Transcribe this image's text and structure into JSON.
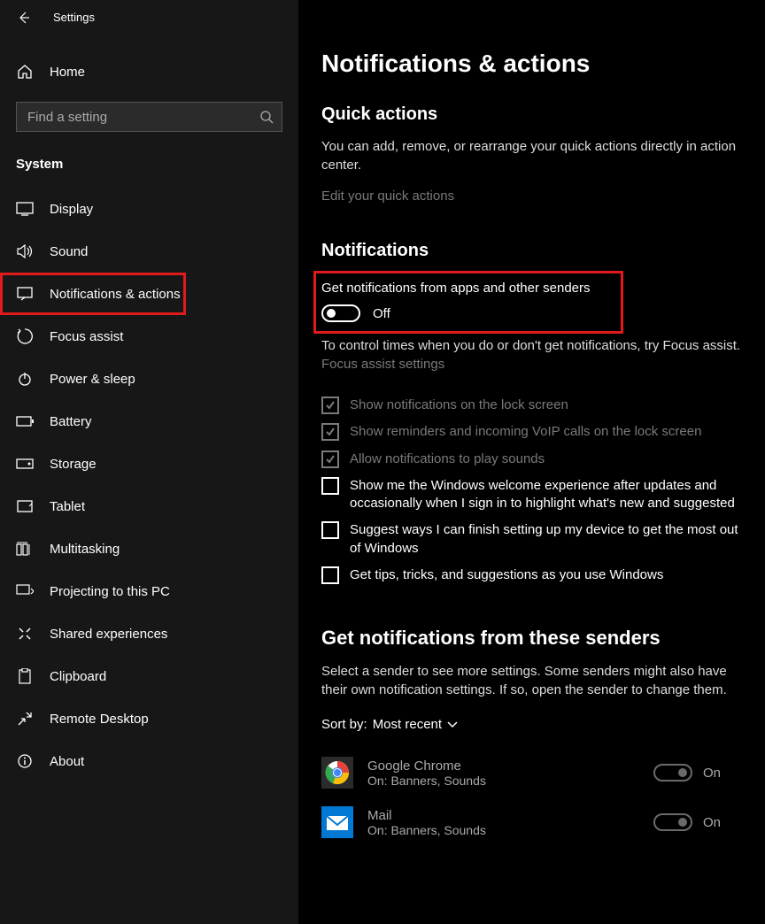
{
  "titlebar": {
    "title": "Settings"
  },
  "sidebar": {
    "home": "Home",
    "search_placeholder": "Find a setting",
    "section": "System",
    "items": [
      {
        "label": "Display"
      },
      {
        "label": "Sound"
      },
      {
        "label": "Notifications & actions"
      },
      {
        "label": "Focus assist"
      },
      {
        "label": "Power & sleep"
      },
      {
        "label": "Battery"
      },
      {
        "label": "Storage"
      },
      {
        "label": "Tablet"
      },
      {
        "label": "Multitasking"
      },
      {
        "label": "Projecting to this PC"
      },
      {
        "label": "Shared experiences"
      },
      {
        "label": "Clipboard"
      },
      {
        "label": "Remote Desktop"
      },
      {
        "label": "About"
      }
    ]
  },
  "main": {
    "heading": "Notifications & actions",
    "quick_actions": {
      "title": "Quick actions",
      "desc": "You can add, remove, or rearrange your quick actions directly in action center.",
      "edit_link": "Edit your quick actions"
    },
    "notifications": {
      "title": "Notifications",
      "main_toggle_label": "Get notifications from apps and other senders",
      "main_toggle_state": "Off",
      "focus_line": "To control times when you do or don't get notifications, try Focus assist.",
      "focus_link": "Focus assist settings",
      "checks": [
        {
          "label": "Show notifications on the lock screen",
          "checked": true,
          "disabled": true
        },
        {
          "label": "Show reminders and incoming VoIP calls on the lock screen",
          "checked": true,
          "disabled": true
        },
        {
          "label": "Allow notifications to play sounds",
          "checked": true,
          "disabled": true
        },
        {
          "label": "Show me the Windows welcome experience after updates and occasionally when I sign in to highlight what's new and suggested",
          "checked": false,
          "disabled": false
        },
        {
          "label": "Suggest ways I can finish setting up my device to get the most out of Windows",
          "checked": false,
          "disabled": false
        },
        {
          "label": "Get tips, tricks, and suggestions as you use Windows",
          "checked": false,
          "disabled": false
        }
      ]
    },
    "senders": {
      "title": "Get notifications from these senders",
      "desc": "Select a sender to see more settings. Some senders might also have their own notification settings. If so, open the sender to change them.",
      "sort_label": "Sort by:",
      "sort_value": "Most recent",
      "list": [
        {
          "name": "Google Chrome",
          "sub": "On: Banners, Sounds",
          "state": "On"
        },
        {
          "name": "Mail",
          "sub": "On: Banners, Sounds",
          "state": "On"
        }
      ]
    }
  }
}
